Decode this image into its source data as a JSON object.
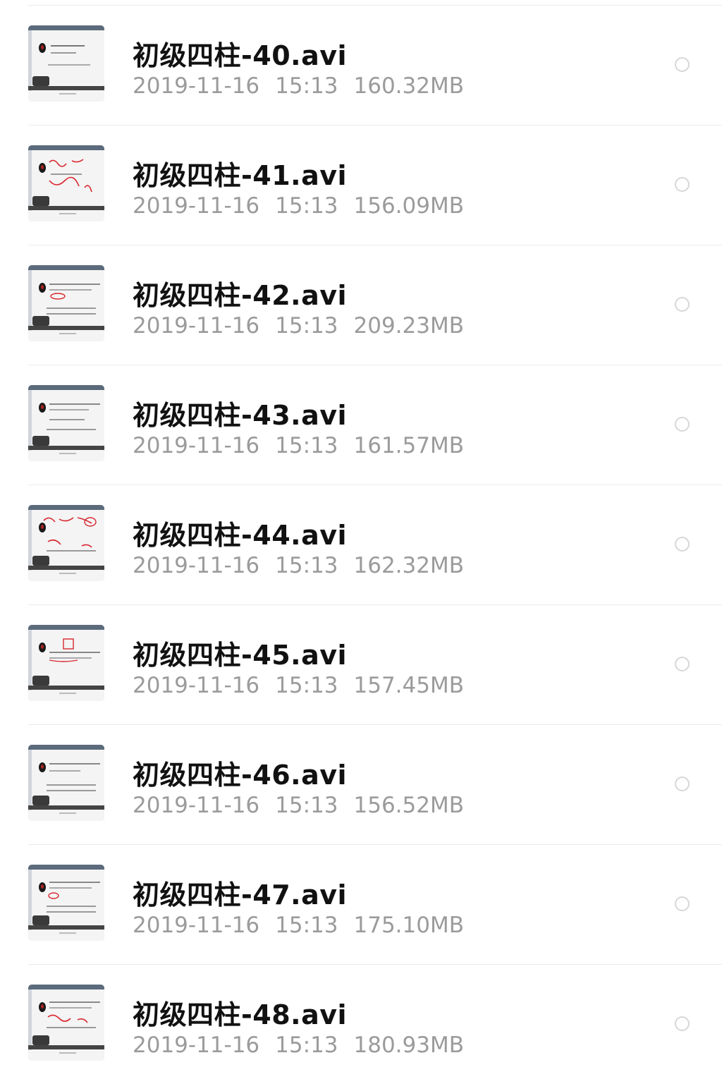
{
  "files": [
    {
      "name": "初级四柱-40.avi",
      "date": "2019-11-16",
      "time": "15:13",
      "size": "160.32MB",
      "thumb_icon": "video-thumbnail-icon",
      "selected": false
    },
    {
      "name": "初级四柱-41.avi",
      "date": "2019-11-16",
      "time": "15:13",
      "size": "156.09MB",
      "thumb_icon": "video-thumbnail-icon",
      "selected": false
    },
    {
      "name": "初级四柱-42.avi",
      "date": "2019-11-16",
      "time": "15:13",
      "size": "209.23MB",
      "thumb_icon": "video-thumbnail-icon",
      "selected": false
    },
    {
      "name": "初级四柱-43.avi",
      "date": "2019-11-16",
      "time": "15:13",
      "size": "161.57MB",
      "thumb_icon": "video-thumbnail-icon",
      "selected": false
    },
    {
      "name": "初级四柱-44.avi",
      "date": "2019-11-16",
      "time": "15:13",
      "size": "162.32MB",
      "thumb_icon": "video-thumbnail-icon",
      "selected": false
    },
    {
      "name": "初级四柱-45.avi",
      "date": "2019-11-16",
      "time": "15:13",
      "size": "157.45MB",
      "thumb_icon": "video-thumbnail-icon",
      "selected": false
    },
    {
      "name": "初级四柱-46.avi",
      "date": "2019-11-16",
      "time": "15:13",
      "size": "156.52MB",
      "thumb_icon": "video-thumbnail-icon",
      "selected": false
    },
    {
      "name": "初级四柱-47.avi",
      "date": "2019-11-16",
      "time": "15:13",
      "size": "175.10MB",
      "thumb_icon": "video-thumbnail-icon",
      "selected": false
    },
    {
      "name": "初级四柱-48.avi",
      "date": "2019-11-16",
      "time": "15:13",
      "size": "180.93MB",
      "thumb_icon": "video-thumbnail-icon",
      "selected": false
    }
  ],
  "colors": {
    "title": "#111111",
    "meta": "#9b9b9b",
    "divider": "#ebebeb",
    "radio_border": "#d7d7d7",
    "annotation_red": "#d8262e"
  }
}
